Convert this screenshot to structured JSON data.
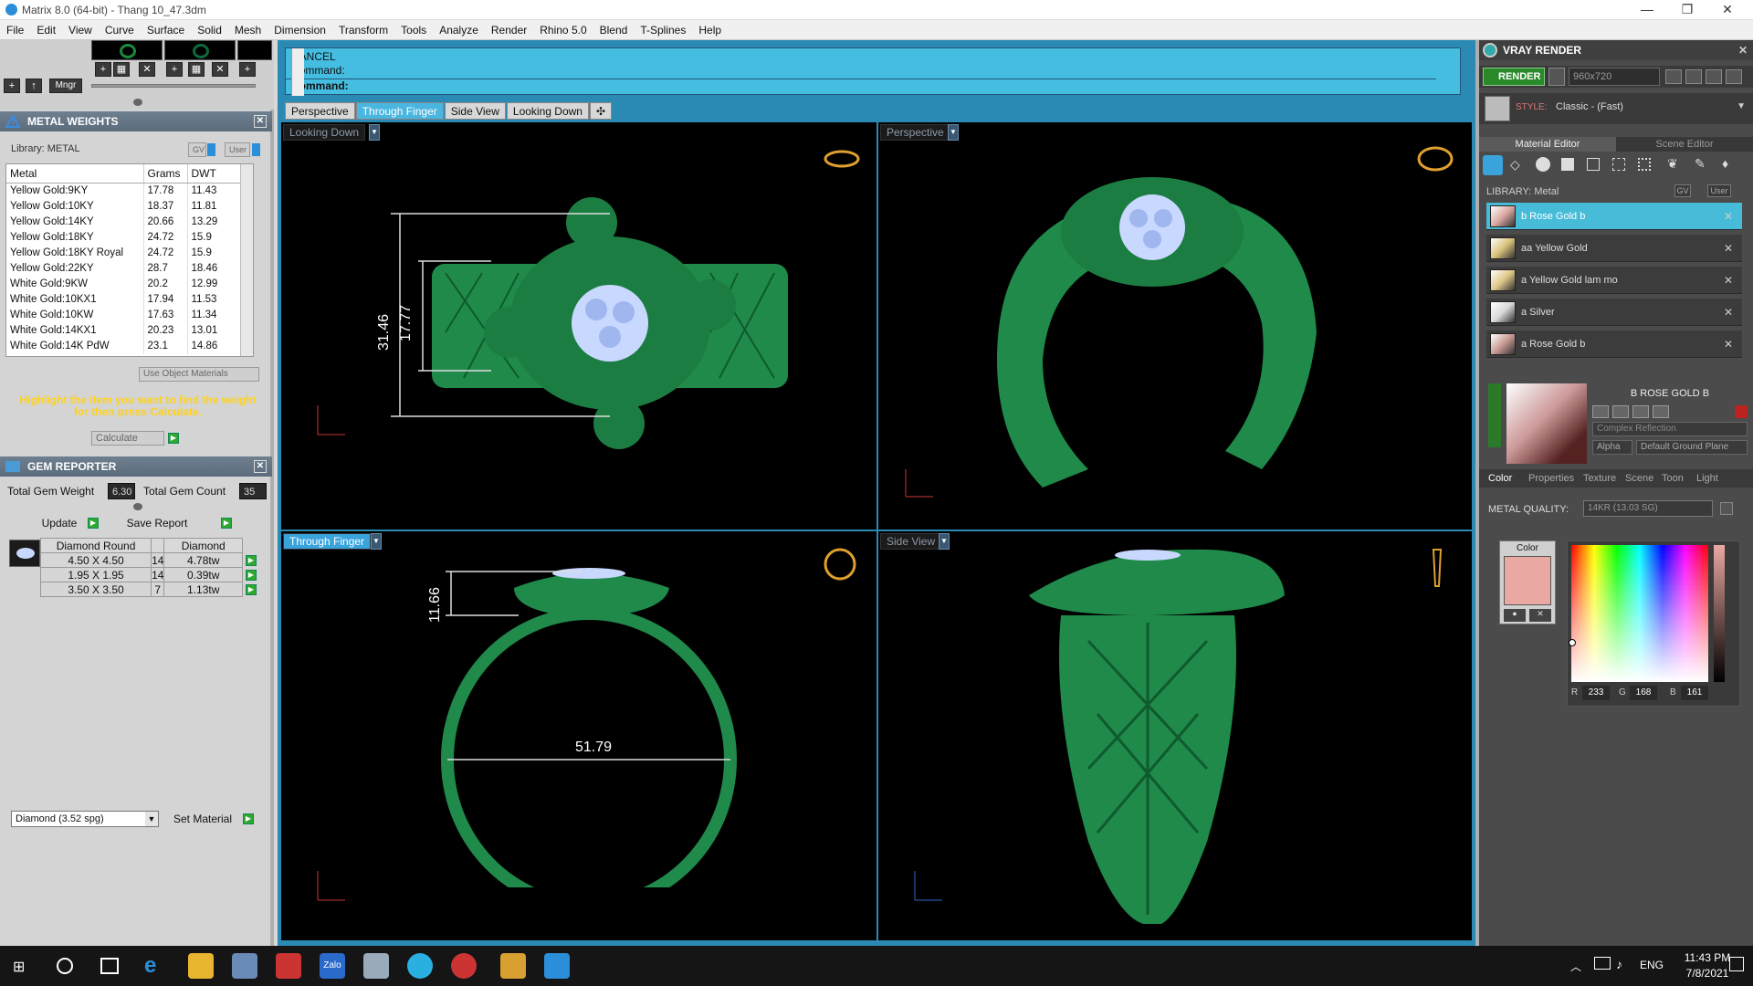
{
  "window": {
    "title": "Matrix 8.0 (64-bit) - Thang 10_47.3dm",
    "minimize": "—",
    "maximize": "❐",
    "close": "✕"
  },
  "menu": [
    "File",
    "Edit",
    "View",
    "Curve",
    "Surface",
    "Solid",
    "Mesh",
    "Dimension",
    "Transform",
    "Tools",
    "Analyze",
    "Render",
    "Rhino 5.0",
    "Blend",
    "T-Splines",
    "Help"
  ],
  "left_toolbar": {
    "mngr_label": "Mngr",
    "add": "+",
    "up": "↑"
  },
  "metal_weights": {
    "title": "METAL WEIGHTS",
    "library_label": "Library: METAL",
    "gv": "GV",
    "user": "User",
    "columns": [
      "Metal",
      "Grams",
      "DWT"
    ],
    "rows": [
      [
        "Yellow Gold:9KY",
        "17.78",
        "11.43"
      ],
      [
        "Yellow Gold:10KY",
        "18.37",
        "11.81"
      ],
      [
        "Yellow Gold:14KY",
        "20.66",
        "13.29"
      ],
      [
        "Yellow Gold:18KY",
        "24.72",
        "15.9"
      ],
      [
        "Yellow Gold:18KY Royal",
        "24.72",
        "15.9"
      ],
      [
        "Yellow Gold:22KY",
        "28.7",
        "18.46"
      ],
      [
        "White Gold:9KW",
        "20.2",
        "12.99"
      ],
      [
        "White Gold:10KX1",
        "17.94",
        "11.53"
      ],
      [
        "White Gold:10KW",
        "17.63",
        "11.34"
      ],
      [
        "White Gold:14KX1",
        "20.23",
        "13.01"
      ],
      [
        "White Gold:14K PdW",
        "23.1",
        "14.86"
      ]
    ],
    "use_object_materials": "Use Object Materials",
    "hint_line1": "Highlight the item you want to find the weight",
    "hint_line2": "for then press Calculate.",
    "calculate": "Calculate"
  },
  "gem_reporter": {
    "title": "GEM REPORTER",
    "total_weight_label": "Total Gem Weight",
    "total_weight_value": "6.30",
    "total_count_label": "Total Gem Count",
    "total_count_value": "35",
    "update": "Update",
    "save_report": "Save Report",
    "columns": [
      "Diamond Round",
      "",
      "Diamond"
    ],
    "rows": [
      [
        "4.50 X 4.50",
        "14",
        "4.78tw"
      ],
      [
        "1.95 X 1.95",
        "14",
        "0.39tw"
      ],
      [
        "3.50 X 3.50",
        "7",
        "1.13tw"
      ]
    ],
    "material_select": "Diamond     (3.52 spg)",
    "set_material": "Set Material"
  },
  "command": {
    "line1": "CANCEL",
    "line2": "Command:",
    "line3": "Command:"
  },
  "view_tabs": [
    "Perspective",
    "Through Finger",
    "Side View",
    "Looking Down",
    "✣"
  ],
  "active_view_tab": "Through Finger",
  "viewports": {
    "top_left": {
      "label": "Looking Down",
      "dim_outer": "31.46",
      "dim_inner": "17.77"
    },
    "top_right": {
      "label": "Perspective"
    },
    "bottom_left": {
      "label": "Through Finger",
      "dim_height": "11.66",
      "dim_diameter": "51.79"
    },
    "bottom_right": {
      "label": "Side View"
    }
  },
  "vray": {
    "title": "VRAY RENDER",
    "render": "RENDER",
    "resolution": "960x720",
    "style_label": "STYLE:",
    "style_value": "Classic - (Fast)",
    "tab_material_editor": "Material Editor",
    "tab_scene_editor": "Scene Editor",
    "library_label": "LIBRARY: Metal",
    "gv": "GV",
    "user": "User",
    "materials": [
      {
        "name": "b Rose Gold b",
        "color": "#d9a8a0"
      },
      {
        "name": "aa Yellow Gold",
        "color": "#d8c27a"
      },
      {
        "name": "a Yellow Gold lam mo",
        "color": "#e0c888"
      },
      {
        "name": "a Silver",
        "color": "#d8d8d8"
      },
      {
        "name": "a Rose Gold b",
        "color": "#c99a92"
      }
    ],
    "selected_material": "B ROSE GOLD B",
    "reflection": "Complex Reflection",
    "alpha": "Alpha",
    "ground_plane": "Default Ground Plane",
    "sub_tabs": [
      "Color",
      "Properties",
      "Texture",
      "Scene",
      "Toon",
      "Light"
    ],
    "metal_quality_label": "METAL QUALITY:",
    "metal_quality_value": "14KR        (13.03 SG)",
    "color_label": "Color",
    "swatch_color": "#e9a8a1",
    "r_label": "R",
    "r": "233",
    "g_label": "G",
    "g": "168",
    "b_label": "B",
    "b": "161"
  },
  "taskbar": {
    "lang": "ENG",
    "time": "11:43 PM",
    "date": "7/8/2021",
    "zalo": "Zalo"
  },
  "colors": {
    "model_green": "#1f8a4a",
    "accent_blue": "#45bde0",
    "gem": "#c8d8ff"
  }
}
